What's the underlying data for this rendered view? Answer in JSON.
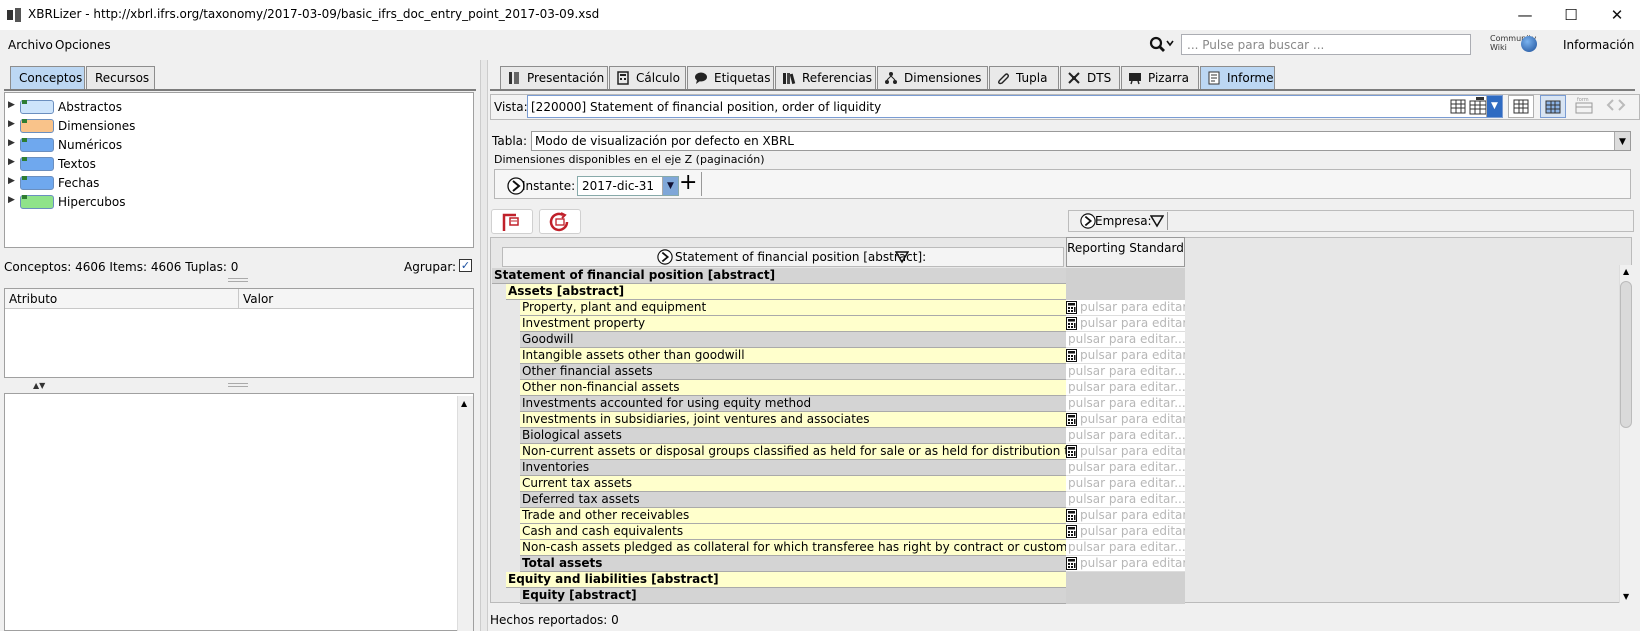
{
  "window": {
    "title": "XBRLizer - http://xbrl.ifrs.org/taxonomy/2017-03-09/basic_ifrs_doc_entry_point_2017-03-09.xsd",
    "minimize": "—",
    "maximize": "☐",
    "close": "✕"
  },
  "menu": {
    "items": [
      "Archivo",
      "Opciones"
    ],
    "info": "Información",
    "community": "Community Wiki"
  },
  "search": {
    "placeholder": "... Pulse para buscar ..."
  },
  "left_tabs": [
    "Conceptos",
    "Recursos"
  ],
  "tree": [
    {
      "label": "Abstractos",
      "color": "#cde4fb"
    },
    {
      "label": "Dimensiones",
      "color": "#f9c38a"
    },
    {
      "label": "Numéricos",
      "color": "#6fa8ee"
    },
    {
      "label": "Textos",
      "color": "#6fa8ee"
    },
    {
      "label": "Fechas",
      "color": "#6fa8ee"
    },
    {
      "label": "Hipercubos",
      "color": "#8fe38a"
    }
  ],
  "status": {
    "concepts": "Conceptos: 4606 Items: 4606 Tuplas: 0",
    "group": "Agrupar:",
    "group_checked": "✓"
  },
  "attr_table": {
    "col1": "Atributo",
    "col2": "Valor"
  },
  "right_tabs": [
    "Presentación",
    "Cálculo",
    "Etiquetas",
    "Referencias",
    "Dimensiones",
    "Tupla",
    "DTS",
    "Pizarra",
    "Informe"
  ],
  "vista": {
    "label": "Vista:",
    "value": "[220000] Statement of financial position, order of liquidity"
  },
  "tabla": {
    "label": "Tabla:",
    "value": "Modo de visualización por defecto en XBRL"
  },
  "z_axis": {
    "label": "Dimensiones disponibles en el eje Z (paginación)",
    "instante_label": "Instante:",
    "instante_value": "2017-dic-31",
    "add": "+"
  },
  "empresa": {
    "label": "Empresa:"
  },
  "grid": {
    "axis_header": "Statement of financial position [abstract]:",
    "column_header": "Reporting Standard",
    "placeholder": "pulsar para editar...",
    "rows": [
      {
        "label": "Statement of financial position [abstract]",
        "level": 0,
        "bold": true,
        "style": "gray",
        "cell": "blank"
      },
      {
        "label": "Assets [abstract]",
        "level": 1,
        "bold": true,
        "style": "yellow",
        "cell": "blank"
      },
      {
        "label": "Property, plant and equipment",
        "level": 2,
        "style": "yellow",
        "cell": "calc"
      },
      {
        "label": "Investment property",
        "level": 2,
        "style": "yellow",
        "cell": "calc"
      },
      {
        "label": "Goodwill",
        "level": 2,
        "style": "gray",
        "cell": "plain"
      },
      {
        "label": "Intangible assets other than goodwill",
        "level": 2,
        "style": "yellow",
        "cell": "calc"
      },
      {
        "label": "Other financial assets",
        "level": 2,
        "style": "gray",
        "cell": "plain"
      },
      {
        "label": "Other non-financial assets",
        "level": 2,
        "style": "yellow",
        "cell": "plain"
      },
      {
        "label": "Investments accounted for using equity method",
        "level": 2,
        "style": "gray",
        "cell": "plain"
      },
      {
        "label": "Investments in subsidiaries, joint ventures and associates",
        "level": 2,
        "style": "yellow",
        "cell": "calc"
      },
      {
        "label": "Biological assets",
        "level": 2,
        "style": "gray",
        "cell": "plain"
      },
      {
        "label": "Non-current assets or disposal groups classified as held for sale or as held for distribution to own...",
        "level": 2,
        "style": "yellow",
        "cell": "calc"
      },
      {
        "label": "Inventories",
        "level": 2,
        "style": "gray",
        "cell": "plain"
      },
      {
        "label": "Current tax assets",
        "level": 2,
        "style": "yellow",
        "cell": "plain"
      },
      {
        "label": "Deferred tax assets",
        "level": 2,
        "style": "gray",
        "cell": "plain"
      },
      {
        "label": "Trade and other receivables",
        "level": 2,
        "style": "yellow",
        "cell": "calc"
      },
      {
        "label": "Cash and cash equivalents",
        "level": 2,
        "style": "yellow",
        "cell": "calc"
      },
      {
        "label": "Non-cash assets pledged as collateral for which transferee has right by contract or custom to sell ...",
        "level": 2,
        "style": "yellow",
        "cell": "plain"
      },
      {
        "label": "Total assets",
        "level": 2,
        "bold": true,
        "style": "gray",
        "cell": "calc"
      },
      {
        "label": "Equity and liabilities [abstract]",
        "level": 1,
        "bold": true,
        "style": "yellow",
        "cell": "blank"
      },
      {
        "label": "Equity [abstract]",
        "level": 2,
        "bold": true,
        "style": "gray",
        "cell": "blank"
      }
    ]
  },
  "footer": {
    "hechos": "Hechos reportados: 0"
  }
}
